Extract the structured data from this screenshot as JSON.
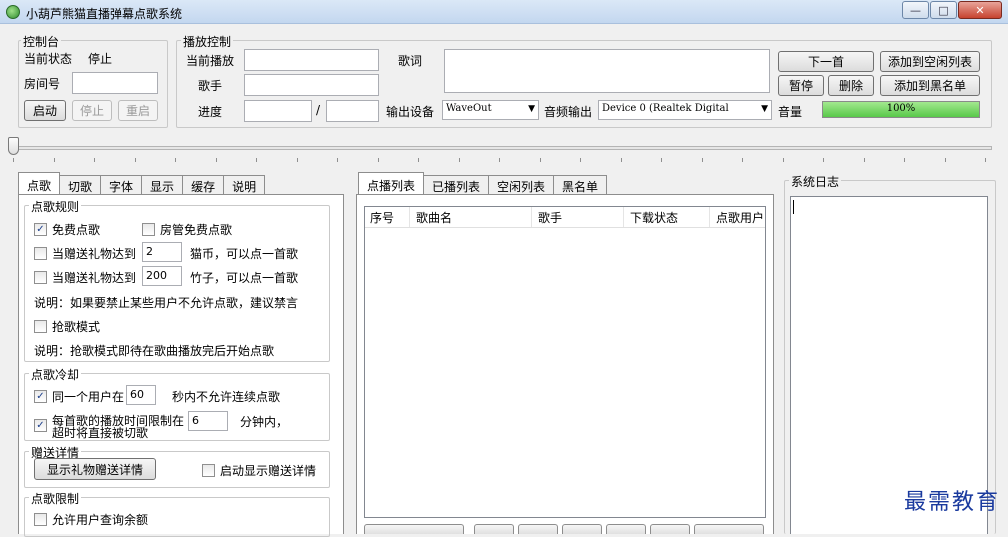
{
  "window": {
    "title": "小葫芦熊猫直播弹幕点歌系统",
    "minimize": "—",
    "maximize": "□",
    "close": "✕"
  },
  "console": {
    "legend": "控制台",
    "status_label": "当前状态",
    "status_value": "停止",
    "room_label": "房间号",
    "room_value": "",
    "start": "启动",
    "stop": "停止",
    "restart": "重启"
  },
  "playback": {
    "legend": "播放控制",
    "now_playing_label": "当前播放",
    "now_playing_value": "",
    "singer_label": "歌手",
    "singer_value": "",
    "progress_label": "进度",
    "progress_current": "",
    "progress_sep": "/",
    "progress_total": "",
    "lyrics_label": "歌词",
    "lyrics_value": "",
    "output_device_label": "输出设备",
    "output_device_value": "WaveOut",
    "audio_output_label": "音频输出",
    "audio_output_value": "Device 0 (Realtek Digital",
    "volume_label": "音量",
    "volume_text": "100%",
    "volume_level": 1.0,
    "next": "下一首",
    "pause": "暂停",
    "delete": "删除",
    "add_to_idle": "添加到空闲列表",
    "add_to_blacklist": "添加到黑名单"
  },
  "left_tabs": [
    "点歌",
    "切歌",
    "字体",
    "显示",
    "缓存",
    "说明"
  ],
  "request_rules": {
    "legend": "点歌规则",
    "free_request": "免费点歌",
    "free_request_checked": true,
    "admin_free": "房管免费点歌",
    "admin_free_checked": false,
    "gift1_prefix": "当赠送礼物达到",
    "gift1_value": "2",
    "gift1_suffix": "猫币，可以点一首歌",
    "gift1_checked": false,
    "gift2_prefix": "当赠送礼物达到",
    "gift2_value": "200",
    "gift2_suffix": "竹子，可以点一首歌",
    "gift2_checked": false,
    "note1": "说明：如果要禁止某些用户不允许点歌，建议禁言",
    "grab_mode": "抢歌模式",
    "grab_mode_checked": false,
    "note2": "说明：抢歌模式即待在歌曲播放完后开始点歌"
  },
  "cooldown": {
    "legend": "点歌冷却",
    "same_user_prefix": "同一个用户在",
    "same_user_value": "60",
    "same_user_suffix": "秒内不允许连续点歌",
    "same_user_checked": true,
    "limit_line1": "每首歌的播放时间限制在",
    "limit_line2": "超时将直接被切歌",
    "limit_value": "6",
    "limit_suffix": "分钟内，",
    "limit_checked": true
  },
  "gift_details": {
    "legend": "赠送详情",
    "show_button": "显示礼物赠送详情",
    "auto_show": "启动显示赠送详情",
    "auto_show_checked": false
  },
  "request_limit": {
    "legend": "点歌限制",
    "allow_query": "允许用户查询余额",
    "allow_query_checked": false
  },
  "playlist_tabs": [
    "点播列表",
    "已播列表",
    "空闲列表",
    "黑名单"
  ],
  "playlist_columns": [
    "序号",
    "歌曲名",
    "歌手",
    "下载状态",
    "点歌用户"
  ],
  "log": {
    "legend": "系统日志"
  },
  "watermark": "最需教育"
}
